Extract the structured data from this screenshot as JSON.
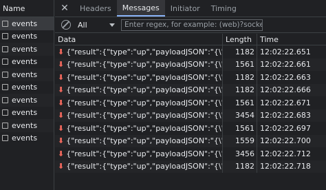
{
  "requests": {
    "header": "Name",
    "items": [
      "events",
      "events",
      "events",
      "events",
      "events",
      "events",
      "events",
      "events",
      "events",
      "events"
    ]
  },
  "tabs": [
    {
      "label": "Headers",
      "active": false
    },
    {
      "label": "Messages",
      "active": true
    },
    {
      "label": "Initiator",
      "active": false
    },
    {
      "label": "Timing",
      "active": false
    }
  ],
  "icons": {
    "close": "close-icon",
    "block": "block-icon",
    "dropdown": "chevron-down-icon",
    "arrow": "arrow-down-icon"
  },
  "filter": {
    "select_value": "All",
    "placeholder": "Enter regex, for example: (web)?socket"
  },
  "grid": {
    "columns": {
      "data": "Data",
      "length": "Length",
      "time": "Time"
    },
    "rows": [
      {
        "data": "{\"result\":{\"type\":\"up\",\"payloadJSON\":\"{\\\"applica...",
        "length": "1182",
        "time": "12:02:22.651"
      },
      {
        "data": "{\"result\":{\"type\":\"up\",\"payloadJSON\":\"{\\\"applica...",
        "length": "1561",
        "time": "12:02:22.661"
      },
      {
        "data": "{\"result\":{\"type\":\"up\",\"payloadJSON\":\"{\\\"applica...",
        "length": "1182",
        "time": "12:02:22.663"
      },
      {
        "data": "{\"result\":{\"type\":\"up\",\"payloadJSON\":\"{\\\"applica...",
        "length": "1182",
        "time": "12:02:22.666"
      },
      {
        "data": "{\"result\":{\"type\":\"up\",\"payloadJSON\":\"{\\\"applica...",
        "length": "1561",
        "time": "12:02:22.671"
      },
      {
        "data": "{\"result\":{\"type\":\"up\",\"payloadJSON\":\"{\\\"applica...",
        "length": "3454",
        "time": "12:02:22.683"
      },
      {
        "data": "{\"result\":{\"type\":\"up\",\"payloadJSON\":\"{\\\"applica...",
        "length": "1561",
        "time": "12:02:22.697"
      },
      {
        "data": "{\"result\":{\"type\":\"up\",\"payloadJSON\":\"{\\\"applica...",
        "length": "1559",
        "time": "12:02:22.700"
      },
      {
        "data": "{\"result\":{\"type\":\"up\",\"payloadJSON\":\"{\\\"applica...",
        "length": "3456",
        "time": "12:02:22.712"
      },
      {
        "data": "{\"result\":{\"type\":\"up\",\"payloadJSON\":\"{\\\"applica...",
        "length": "1182",
        "time": "12:02:22.718"
      }
    ]
  }
}
